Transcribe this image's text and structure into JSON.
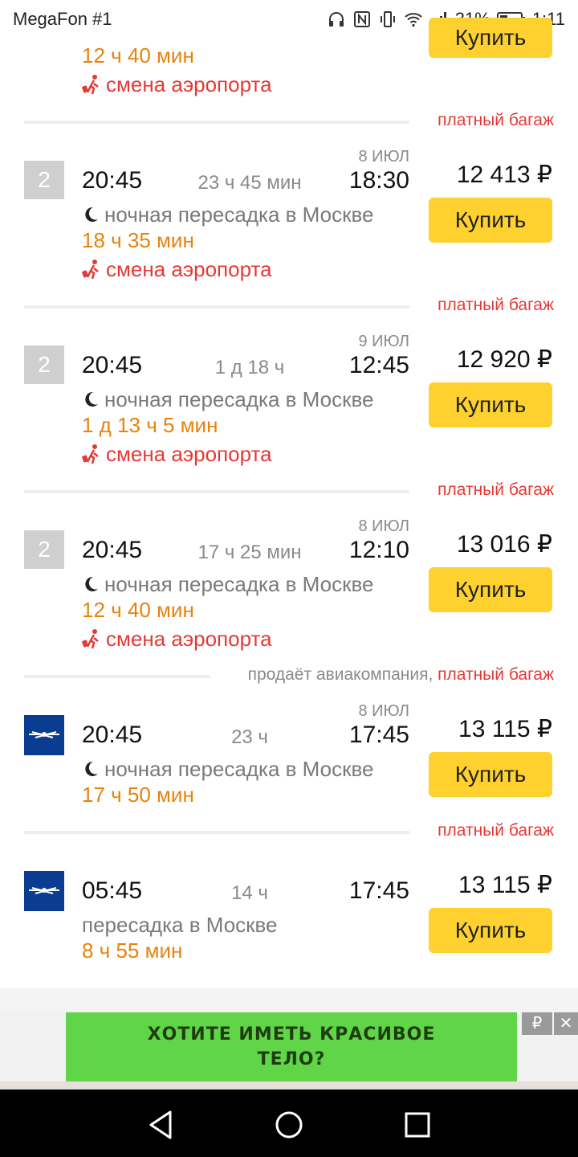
{
  "status_bar": {
    "carrier": "MegaFon #1",
    "battery": "31%",
    "time": "1:11"
  },
  "partial_top": {
    "price_button": "Купить",
    "layover": "12 ч 40 мин",
    "airport_change": "смена аэропорта"
  },
  "flights": [
    {
      "tag_extra": "",
      "tag": "платный багаж",
      "badge": "2",
      "logo": "",
      "dep": "20:45",
      "duration": "23 ч 45 мин",
      "date": "8 ИЮЛ",
      "arr": "18:30",
      "price": "12 413 ₽",
      "buy": "Купить",
      "transfer": "ночная пересадка в Москве",
      "layover": "18 ч 35 мин",
      "airport_change": "смена аэропорта"
    },
    {
      "tag_extra": "",
      "tag": "платный багаж",
      "badge": "2",
      "logo": "",
      "dep": "20:45",
      "duration": "1 д 18 ч",
      "date": "9 ИЮЛ",
      "arr": "12:45",
      "price": "12 920 ₽",
      "buy": "Купить",
      "transfer": "ночная пересадка в Москве",
      "layover": "1 д 13 ч 5 мин",
      "airport_change": "смена аэропорта"
    },
    {
      "tag_extra": "",
      "tag": "платный багаж",
      "badge": "2",
      "logo": "",
      "dep": "20:45",
      "duration": "17 ч 25 мин",
      "date": "8 ИЮЛ",
      "arr": "12:10",
      "price": "13 016 ₽",
      "buy": "Купить",
      "transfer": "ночная пересадка в Москве",
      "layover": "12 ч 40 мин",
      "airport_change": "смена аэропорта"
    },
    {
      "tag_extra": "продаёт авиакомпания,",
      "tag": "платный багаж",
      "badge": "",
      "logo": "aeroflot-logo",
      "dep": "20:45",
      "duration": "23 ч",
      "date": "8 ИЮЛ",
      "arr": "17:45",
      "price": "13 115 ₽",
      "buy": "Купить",
      "transfer": "ночная пересадка в Москве",
      "layover": "17 ч 50 мин",
      "airport_change": ""
    },
    {
      "tag_extra": "",
      "tag": "платный багаж",
      "badge": "",
      "logo": "aeroflot-logo",
      "dep": "05:45",
      "duration": "14 ч",
      "date": "",
      "arr": "17:45",
      "price": "13 115 ₽",
      "buy": "Купить",
      "transfer": "пересадка в Москве",
      "layover": "8 ч 55 мин",
      "airport_change": ""
    }
  ],
  "ad": {
    "line1": "ХОТИТЕ ИМЕТЬ КРАСИВОЕ",
    "line2": "ТЕЛО?",
    "rub_icon": "₽",
    "close_icon": "✕"
  },
  "colors": {
    "accent_button": "#ffd12e",
    "layover_orange": "#e8820c",
    "warning_red": "#e53935"
  }
}
